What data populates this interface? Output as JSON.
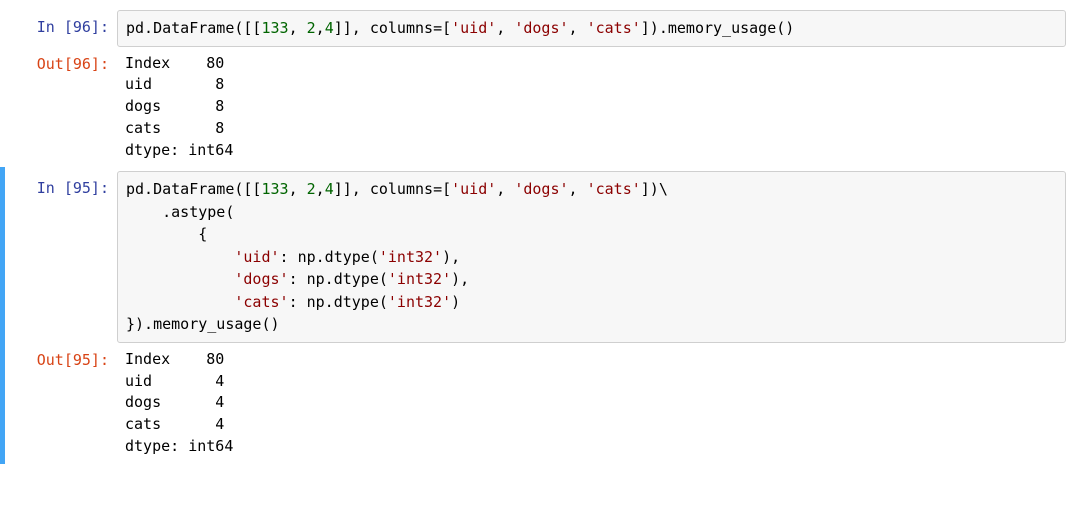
{
  "cells": [
    {
      "prompt_in": "In [96]:",
      "prompt_out": "Out[96]:",
      "code_tokens": [
        [
          "plain",
          "pd.DataFrame([["
        ],
        [
          "num",
          "133"
        ],
        [
          "plain",
          ", "
        ],
        [
          "num",
          "2"
        ],
        [
          "plain",
          ","
        ],
        [
          "num",
          "4"
        ],
        [
          "plain",
          "]], columns"
        ],
        [
          "op",
          "="
        ],
        [
          "plain",
          "["
        ],
        [
          "str",
          "'uid'"
        ],
        [
          "plain",
          ", "
        ],
        [
          "str",
          "'dogs'"
        ],
        [
          "plain",
          ", "
        ],
        [
          "str",
          "'cats'"
        ],
        [
          "plain",
          "]).memory_usage()"
        ]
      ],
      "output_lines": [
        "Index    80",
        "uid       8",
        "dogs      8",
        "cats      8",
        "dtype: int64"
      ],
      "selected": false
    },
    {
      "prompt_in": "In [95]:",
      "prompt_out": "Out[95]:",
      "code_tokens": [
        [
          "plain",
          "pd.DataFrame([["
        ],
        [
          "num",
          "133"
        ],
        [
          "plain",
          ", "
        ],
        [
          "num",
          "2"
        ],
        [
          "plain",
          ","
        ],
        [
          "num",
          "4"
        ],
        [
          "plain",
          "]], columns"
        ],
        [
          "op",
          "="
        ],
        [
          "plain",
          "["
        ],
        [
          "str",
          "'uid'"
        ],
        [
          "plain",
          ", "
        ],
        [
          "str",
          "'dogs'"
        ],
        [
          "plain",
          ", "
        ],
        [
          "str",
          "'cats'"
        ],
        [
          "plain",
          "])\\\n"
        ],
        [
          "plain",
          "    .astype(\n"
        ],
        [
          "plain",
          "        {\n"
        ],
        [
          "plain",
          "            "
        ],
        [
          "str",
          "'uid'"
        ],
        [
          "plain",
          ": np.dtype("
        ],
        [
          "str",
          "'int32'"
        ],
        [
          "plain",
          "),\n"
        ],
        [
          "plain",
          "            "
        ],
        [
          "str",
          "'dogs'"
        ],
        [
          "plain",
          ": np.dtype("
        ],
        [
          "str",
          "'int32'"
        ],
        [
          "plain",
          "),\n"
        ],
        [
          "plain",
          "            "
        ],
        [
          "str",
          "'cats'"
        ],
        [
          "plain",
          ": np.dtype("
        ],
        [
          "str",
          "'int32'"
        ],
        [
          "plain",
          ")\n"
        ],
        [
          "plain",
          "}).memory_usage()"
        ]
      ],
      "output_lines": [
        "Index    80",
        "uid       4",
        "dogs      4",
        "cats      4",
        "dtype: int64"
      ],
      "selected": true
    }
  ]
}
